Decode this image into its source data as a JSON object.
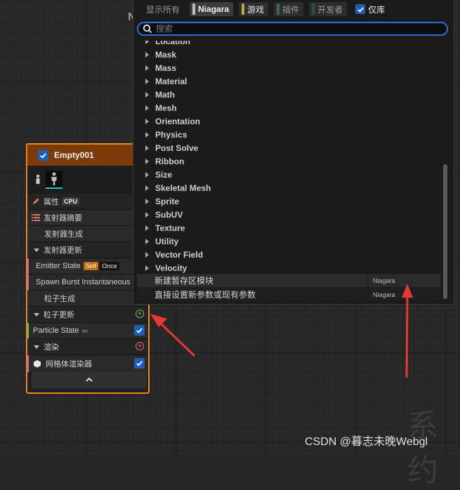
{
  "filters": [
    {
      "label": "显示所有",
      "active": false,
      "color": ""
    },
    {
      "label": "Niagara",
      "active": true,
      "color": "#bfbfbf"
    },
    {
      "label": "游戏",
      "active": false,
      "color": "#c9a14a"
    },
    {
      "label": "插件",
      "active": false,
      "color": "#3f6b4a"
    },
    {
      "label": "开发者",
      "active": false,
      "color": "#2f4f4f"
    },
    {
      "label": "仅库",
      "active": true,
      "color": "#1e5fb5"
    }
  ],
  "search": {
    "placeholder": "搜索",
    "value": ""
  },
  "categories": [
    "Location",
    "Mask",
    "Mass",
    "Material",
    "Math",
    "Mesh",
    "Orientation",
    "Physics",
    "Post Solve",
    "Ribbon",
    "Size",
    "Skeletal Mesh",
    "Sprite",
    "SubUV",
    "Texture",
    "Utility",
    "Vector Field",
    "Velocity"
  ],
  "actions": [
    {
      "label": "新建暂存区模块",
      "source": "Niagara"
    },
    {
      "label": "直接设置新参数或现有参数",
      "source": "Niagara"
    }
  ],
  "node": {
    "title": "Empty001",
    "props_label": "属性",
    "cpu_badge": "CPU",
    "rows": {
      "emitter_summary": "发射器摘要",
      "emitter_spawn": "发射器生成",
      "emitter_update": "发射器更新",
      "emitter_state": "Emitter State",
      "self_tag": "Self",
      "once_tag": "Once",
      "spawn_burst": "Spawn Burst Instantaneous",
      "particle_spawn": "粒子生成",
      "particle_update": "粒子更新",
      "particle_state": "Particle State",
      "render": "渲染",
      "mesh_renderer": "网格体渲染器"
    }
  },
  "background": {
    "header_letter": "N",
    "big_text": "系约"
  },
  "watermark": "CSDN @暮志未晚Webgl",
  "colors": {
    "accent": "#e8891d",
    "selection": "#2a6fd8",
    "arrow": "#e53935"
  }
}
